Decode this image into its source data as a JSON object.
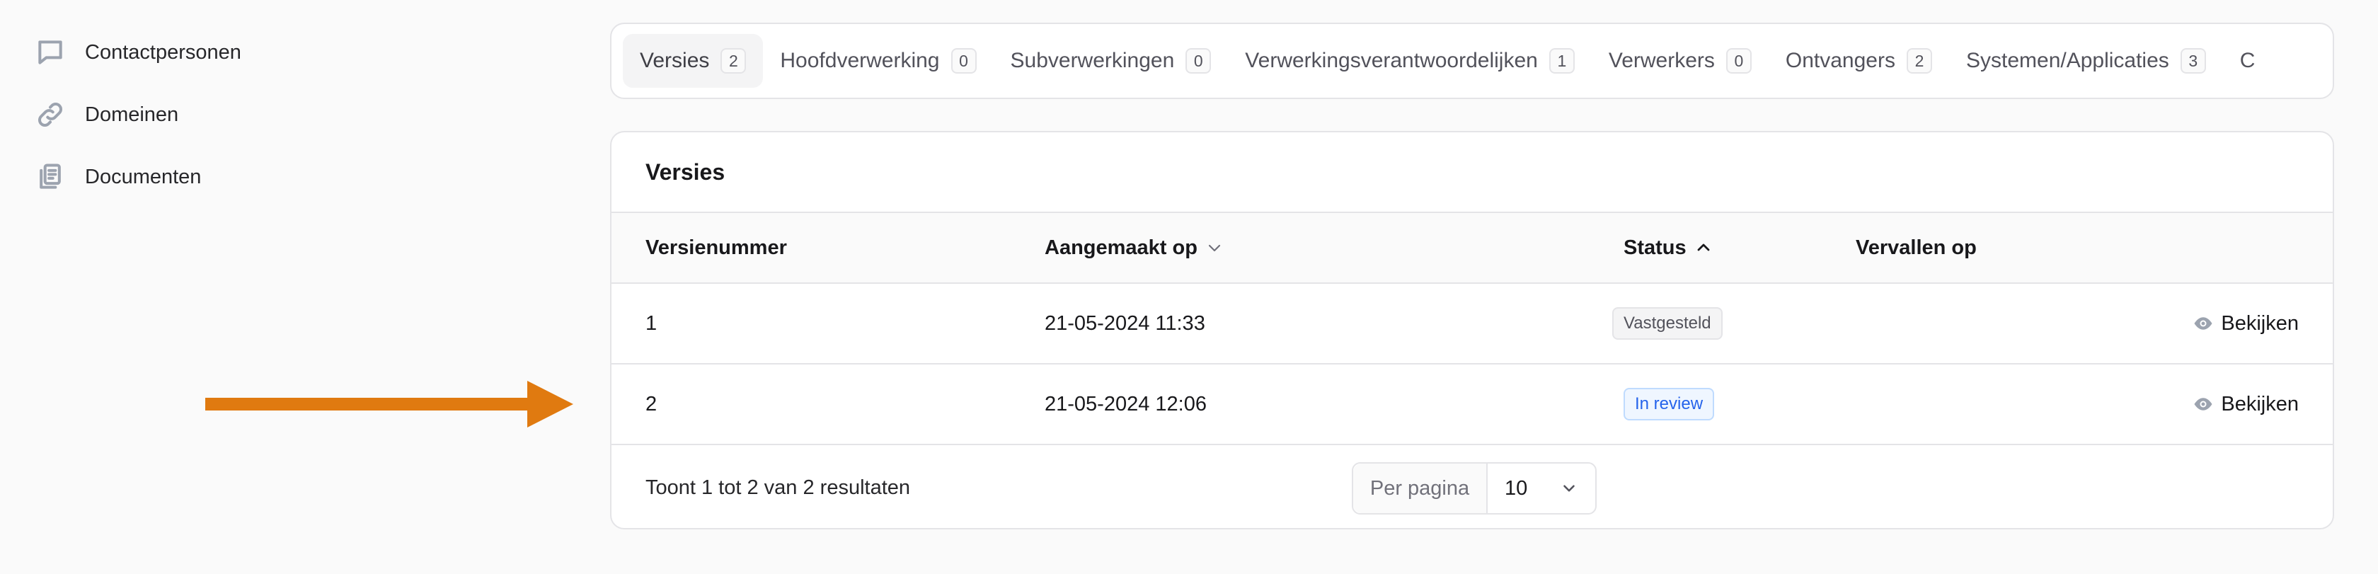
{
  "sidebar": {
    "items": [
      {
        "label": "Contactpersonen",
        "icon": "chat-bubble-icon"
      },
      {
        "label": "Domeinen",
        "icon": "link-icon"
      },
      {
        "label": "Documenten",
        "icon": "documents-icon"
      }
    ]
  },
  "tabs": [
    {
      "label": "Versies",
      "count": "2",
      "active": true
    },
    {
      "label": "Hoofdverwerking",
      "count": "0"
    },
    {
      "label": "Subverwerkingen",
      "count": "0"
    },
    {
      "label": "Verwerkingsverantwoordelijken",
      "count": "1"
    },
    {
      "label": "Verwerkers",
      "count": "0"
    },
    {
      "label": "Ontvangers",
      "count": "2"
    },
    {
      "label": "Systemen/Applicaties",
      "count": "3"
    },
    {
      "label": "C",
      "count": ""
    }
  ],
  "card": {
    "title": "Versies",
    "columns": {
      "versienummer": "Versienummer",
      "aangemaakt": "Aangemaakt op",
      "status": "Status",
      "vervallen": "Vervallen op"
    },
    "rows": [
      {
        "versienummer": "1",
        "aangemaakt": "21-05-2024 11:33",
        "status": "Vastgesteld",
        "vervallen": "",
        "action": "Bekijken"
      },
      {
        "versienummer": "2",
        "aangemaakt": "21-05-2024 12:06",
        "status": "In review",
        "vervallen": "",
        "action": "Bekijken"
      }
    ],
    "footer": {
      "summary": "Toont 1 tot 2 van 2 resultaten",
      "per_page_label": "Per pagina",
      "per_page_value": "10"
    }
  },
  "colors": {
    "arrow": "#e07a10",
    "badge_blue": "#2563eb",
    "border": "#e4e4e7"
  }
}
